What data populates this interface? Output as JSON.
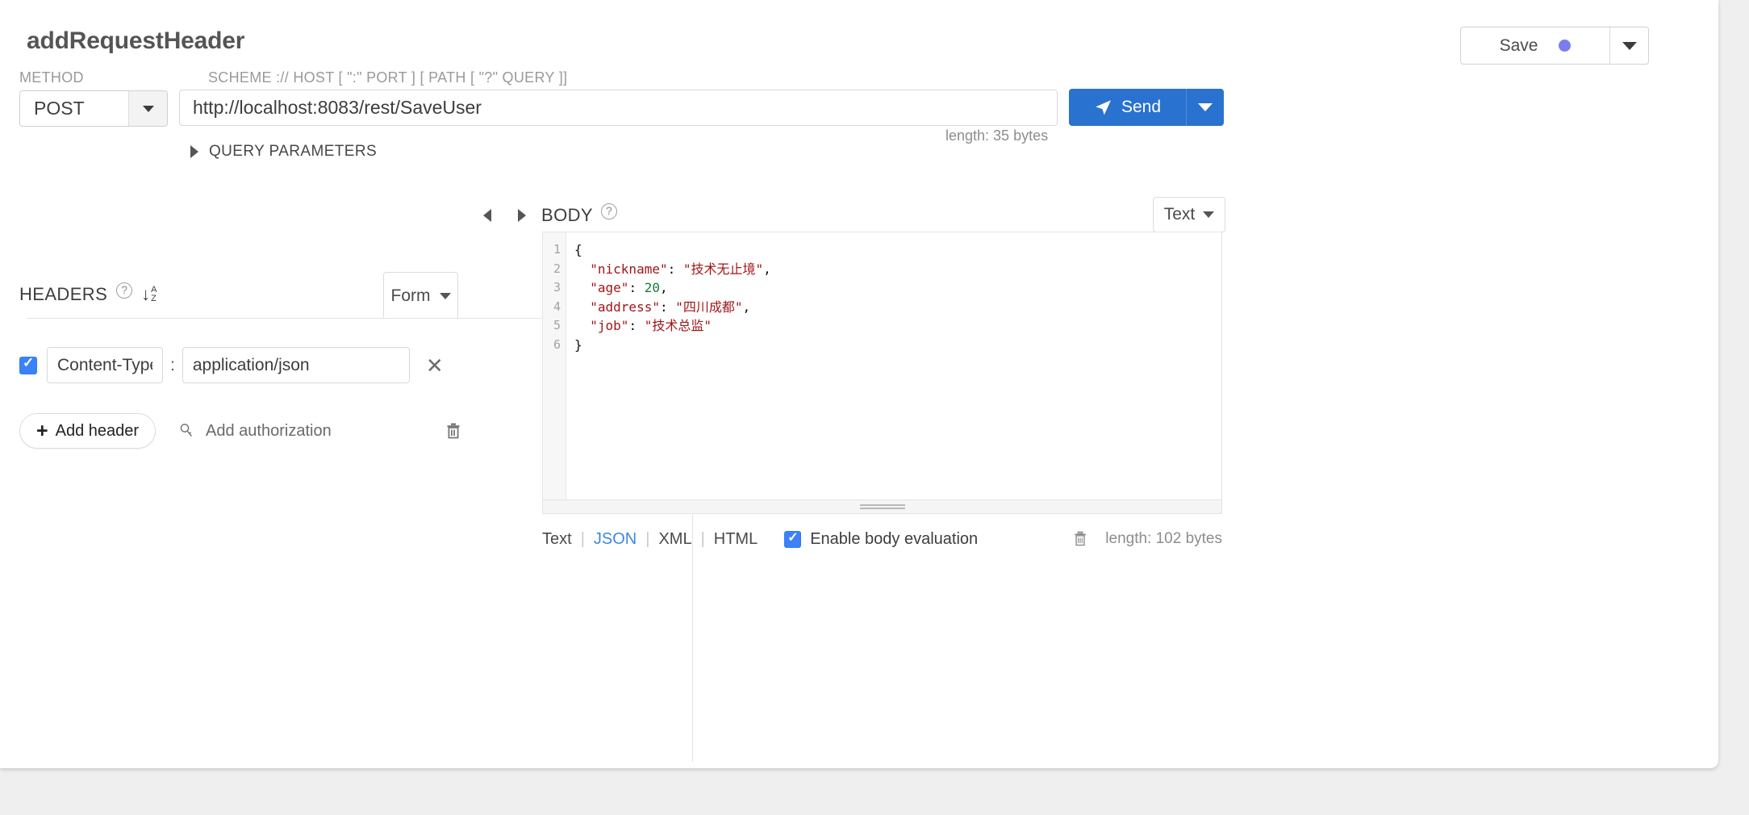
{
  "window": {
    "title": "addRequestHeader"
  },
  "toolbar": {
    "save_label": "Save",
    "save_dropdown_icon": "chevron-down-icon",
    "save_dirty_dot_color": "#7b7ced"
  },
  "request": {
    "method_label": "METHOD",
    "method_value": "POST",
    "url_label": "SCHEME :// HOST [ \":\" PORT ] [ PATH [ \"?\" QUERY ]]",
    "url_value": "http://localhost:8083/rest/SaveUser",
    "url_placeholder": "http://",
    "url_length": "length: 35 bytes",
    "send_label": "Send",
    "send_icon": "paper-plane-icon",
    "send_color": "#2a72cf",
    "query_parameters_label": "QUERY PARAMETERS",
    "query_parameters_expanded": false
  },
  "headers_panel": {
    "title": "HEADERS",
    "help_icon": "question-circle-icon",
    "sort_icon": "sort-alpha-asc-icon",
    "sort_arrow": "↓",
    "sort_a": "A",
    "sort_z": "Z",
    "view_mode": "Form",
    "collapse_left_icon": "triangle-left-icon",
    "collapse_right_icon": "triangle-right-icon",
    "rows": [
      {
        "enabled": true,
        "key": "Content-Type",
        "separator": ":",
        "value": "application/json",
        "remove_icon": "close-icon"
      }
    ],
    "add_header_label": "Add header",
    "add_header_icon": "plus-icon",
    "add_authorization_label": "Add authorization",
    "add_authorization_icon": "key-icon",
    "delete_all_icon": "trash-icon"
  },
  "body_panel": {
    "title": "BODY",
    "help_icon": "question-circle-icon",
    "view_mode": "Text",
    "line_numbers": [
      "1",
      "2",
      "3",
      "4",
      "5",
      "6"
    ],
    "code_lines": [
      [
        {
          "t": "{",
          "k": "punc"
        }
      ],
      [
        {
          "t": "  \"nickname\"",
          "k": "str"
        },
        {
          "t": ": ",
          "k": "punc"
        },
        {
          "t": "\"技术无止境\"",
          "k": "str"
        },
        {
          "t": ",",
          "k": "punc"
        }
      ],
      [
        {
          "t": "  \"age\"",
          "k": "str"
        },
        {
          "t": ": ",
          "k": "punc"
        },
        {
          "t": "20",
          "k": "num"
        },
        {
          "t": ",",
          "k": "punc"
        }
      ],
      [
        {
          "t": "  \"address\"",
          "k": "str"
        },
        {
          "t": ": ",
          "k": "punc"
        },
        {
          "t": "\"四川成都\"",
          "k": "str"
        },
        {
          "t": ",",
          "k": "punc"
        }
      ],
      [
        {
          "t": "  \"job\"",
          "k": "str"
        },
        {
          "t": ": ",
          "k": "punc"
        },
        {
          "t": "\"技术总监\"",
          "k": "str"
        }
      ],
      [
        {
          "t": "}",
          "k": "punc"
        }
      ]
    ],
    "formats": [
      {
        "label": "Text",
        "active": false
      },
      {
        "label": "JSON",
        "active": true
      },
      {
        "label": "XML",
        "active": false
      },
      {
        "label": "HTML",
        "active": false
      }
    ],
    "format_separator": "|",
    "enable_body_evaluation_label": "Enable body evaluation",
    "enable_body_evaluation_checked": true,
    "clear_body_icon": "trash-icon",
    "body_length": "length: 102 bytes",
    "resize_handle_icon": "grip-horizontal-icon"
  }
}
